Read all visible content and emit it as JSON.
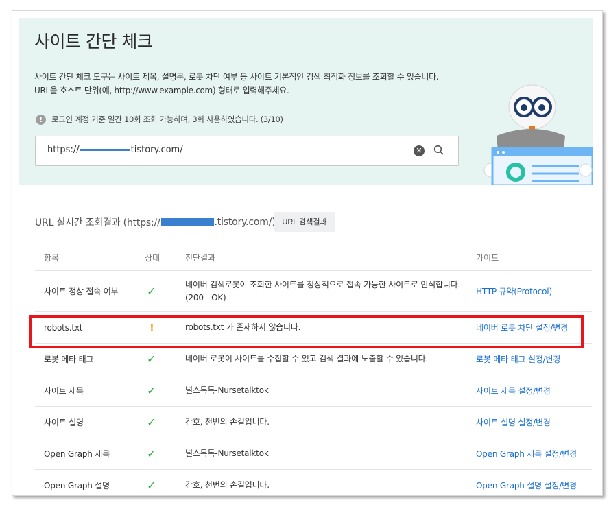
{
  "page": {
    "title": "사이트 간단 체크",
    "description_line1": "사이트 간단 체크 도구는 사이트 제목, 설명문, 로봇 차단 여부 등 사이트 기본적인 검색 최적화 정보를 조회할 수 있습니다.",
    "description_line2": "URL을 호스트 단위(예, http://www.example.com) 형태로 입력해주세요.",
    "notice": "로그인 계정 기준 일간 10회 조회 가능하며, 3회 사용하였습니다. (3/10)"
  },
  "search": {
    "value_prefix": "https://",
    "value_suffix": "tistory.com/"
  },
  "results": {
    "title_prefix": "URL 실시간 조회결과 (https://",
    "title_suffix": ".tistory.com/)",
    "button_label": "URL 검색결과",
    "columns": [
      "항목",
      "상태",
      "진단결과",
      "가이드"
    ],
    "rows": [
      {
        "item": "사이트 정상 접속 여부",
        "status": "ok",
        "result": "네이버 검색로봇이 조회한 사이트를 정상적으로 접속 가능한 사이트로 인식합니다. (200 - OK)",
        "guide": "HTTP 규약(Protocol)"
      },
      {
        "item": "robots.txt",
        "status": "warning",
        "result": "robots.txt 가 존재하지 않습니다.",
        "guide": "네이버 로봇 차단 설정/변경"
      },
      {
        "item": "로봇 메타 태그",
        "status": "ok",
        "result": "네이버 로봇이 사이트를 수집할 수 있고 검색 결과에 노출할 수 있습니다.",
        "guide": "로봇 메타 태그 설정/변경"
      },
      {
        "item": "사이트 제목",
        "status": "ok",
        "result": "널스톡톡-Nursetalktok",
        "guide": "사이트 제목 설정/변경"
      },
      {
        "item": "사이트 설명",
        "status": "ok",
        "result": "간호, 천번의 손길입니다.",
        "guide": "사이트 설명 설정/변경"
      },
      {
        "item": "Open Graph 제목",
        "status": "ok",
        "result": "널스톡톡-Nursetalktok",
        "guide": "Open Graph 제목 설정/변경"
      },
      {
        "item": "Open Graph 설명",
        "status": "ok",
        "result": "간호, 천번의 손길입니다.",
        "guide": "Open Graph 설명 설정/변경"
      }
    ]
  },
  "icons": {
    "ok": "check-icon",
    "warning": "exclamation-icon",
    "info": "info-icon"
  },
  "colors": {
    "hero_bg": "#e6f5f2",
    "ok": "#2eb13f",
    "warning": "#f5a623",
    "link": "#1a6fd1",
    "highlight": "#e8151a"
  }
}
